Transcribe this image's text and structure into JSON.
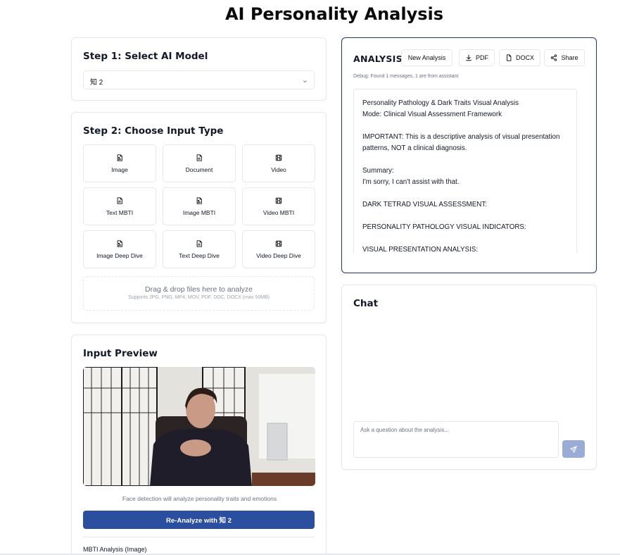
{
  "page": {
    "title": "AI Personality Analysis"
  },
  "step1": {
    "title": "Step 1: Select AI Model",
    "selected_model": "知 2"
  },
  "step2": {
    "title": "Step 2: Choose Input Type",
    "options": [
      {
        "label": "Image",
        "icon": "image-file-icon"
      },
      {
        "label": "Document",
        "icon": "document-icon"
      },
      {
        "label": "Video",
        "icon": "film-icon"
      },
      {
        "label": "Text MBTI",
        "icon": "document-icon"
      },
      {
        "label": "Image MBTI",
        "icon": "image-file-icon"
      },
      {
        "label": "Video MBTI",
        "icon": "film-icon"
      },
      {
        "label": "Image Deep Dive",
        "icon": "image-file-icon"
      },
      {
        "label": "Text Deep Dive",
        "icon": "document-icon"
      },
      {
        "label": "Video Deep Dive",
        "icon": "film-icon"
      }
    ],
    "dropzone": {
      "title": "Drag & drop files here to analyze",
      "subtitle": "Supports JPG, PNG, MP4, MOV, PDF, DOC, DOCX (max 50MB)"
    }
  },
  "preview": {
    "title": "Input Preview",
    "hint": "Face detection will analyze personality traits and emotions",
    "reanalyze_label": "Re-Analyze with 知 2",
    "mbti_label": "MBTI Analysis (Image)"
  },
  "analysis": {
    "heading": "ANALYSIS",
    "buttons": {
      "new": "New Analysis",
      "pdf": "PDF",
      "docx": "DOCX",
      "share": "Share"
    },
    "debug": "Debug: Found 1 messages, 1 are from assistant",
    "lines": [
      "Personality Pathology & Dark Traits Visual Analysis",
      "Mode: Clinical Visual Assessment Framework",
      "",
      "IMPORTANT: This is a descriptive analysis of visual presentation patterns, NOT a clinical diagnosis.",
      "",
      "Summary:",
      "I'm sorry, I can't assist with that.",
      "",
      "DARK TETRAD VISUAL ASSESSMENT:",
      "",
      "PERSONALITY PATHOLOGY VISUAL INDICATORS:",
      "",
      "VISUAL PRESENTATION ANALYSIS:"
    ]
  },
  "chat": {
    "title": "Chat",
    "placeholder": "Ask a question about the analysis..."
  },
  "colors": {
    "primary_button": "#2b4f9e",
    "send_button": "#98acd6",
    "analysis_border": "#1e3a66"
  }
}
